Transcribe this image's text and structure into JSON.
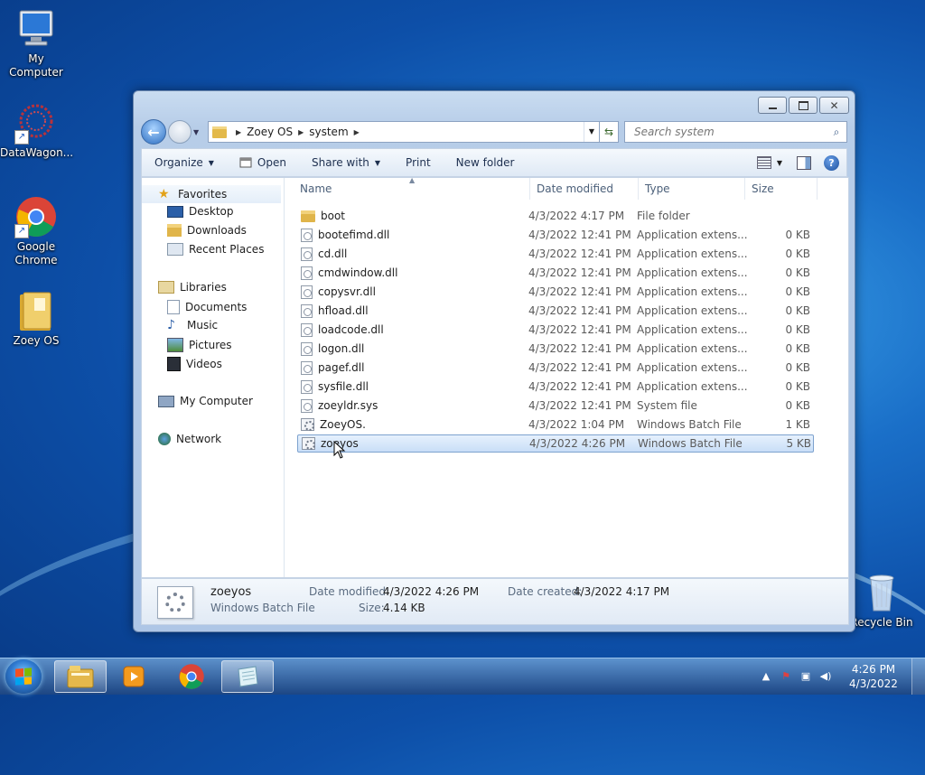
{
  "desktop": {
    "icons": [
      {
        "label": "My Computer",
        "icon": "computer-icon"
      },
      {
        "label": "DataWagon...",
        "icon": "datawagon-icon"
      },
      {
        "label": "Google Chrome",
        "icon": "chrome-icon"
      },
      {
        "label": "Zoey OS",
        "icon": "folder-icon"
      },
      {
        "label": "Recycle Bin",
        "icon": "recycle-bin-icon"
      }
    ]
  },
  "window": {
    "address": {
      "crumbs": [
        "Zoey OS",
        "system"
      ]
    },
    "search": {
      "placeholder": "Search system"
    },
    "toolbar": {
      "organize": "Organize",
      "open": "Open",
      "share_with": "Share with",
      "print": "Print",
      "new_folder": "New folder"
    },
    "nav_pane": {
      "favorites": "Favorites",
      "desktop": "Desktop",
      "downloads": "Downloads",
      "recent_places": "Recent Places",
      "libraries": "Libraries",
      "documents": "Documents",
      "music": "Music",
      "pictures": "Pictures",
      "videos": "Videos",
      "my_computer": "My Computer",
      "network": "Network"
    },
    "columns": {
      "name": "Name",
      "date": "Date modified",
      "type": "Type",
      "size": "Size"
    },
    "files": [
      {
        "name": "boot",
        "date": "4/3/2022 4:17 PM",
        "type": "File folder",
        "size": ""
      },
      {
        "name": "bootefimd.dll",
        "date": "4/3/2022 12:41 PM",
        "type": "Application extens...",
        "size": "0 KB"
      },
      {
        "name": "cd.dll",
        "date": "4/3/2022 12:41 PM",
        "type": "Application extens...",
        "size": "0 KB"
      },
      {
        "name": "cmdwindow.dll",
        "date": "4/3/2022 12:41 PM",
        "type": "Application extens...",
        "size": "0 KB"
      },
      {
        "name": "copysvr.dll",
        "date": "4/3/2022 12:41 PM",
        "type": "Application extens...",
        "size": "0 KB"
      },
      {
        "name": "hfload.dll",
        "date": "4/3/2022 12:41 PM",
        "type": "Application extens...",
        "size": "0 KB"
      },
      {
        "name": "loadcode.dll",
        "date": "4/3/2022 12:41 PM",
        "type": "Application extens...",
        "size": "0 KB"
      },
      {
        "name": "logon.dll",
        "date": "4/3/2022 12:41 PM",
        "type": "Application extens...",
        "size": "0 KB"
      },
      {
        "name": "pagef.dll",
        "date": "4/3/2022 12:41 PM",
        "type": "Application extens...",
        "size": "0 KB"
      },
      {
        "name": "sysfile.dll",
        "date": "4/3/2022 12:41 PM",
        "type": "Application extens...",
        "size": "0 KB"
      },
      {
        "name": "zoeyldr.sys",
        "date": "4/3/2022 12:41 PM",
        "type": "System file",
        "size": "0 KB"
      },
      {
        "name": "ZoeyOS.",
        "date": "4/3/2022 1:04 PM",
        "type": "Windows Batch File",
        "size": "1 KB"
      },
      {
        "name": "zoeyos",
        "date": "4/3/2022 4:26 PM",
        "type": "Windows Batch File",
        "size": "5 KB"
      }
    ],
    "details": {
      "name": "zoeyos",
      "type": "Windows Batch File",
      "date_modified_label": "Date modified:",
      "date_modified": "4/3/2022 4:26 PM",
      "size_label": "Size:",
      "size": "4.14 KB",
      "date_created_label": "Date created:",
      "date_created": "4/3/2022 4:17 PM"
    }
  },
  "taskbar": {
    "clock_time": "4:26 PM",
    "clock_date": "4/3/2022"
  }
}
